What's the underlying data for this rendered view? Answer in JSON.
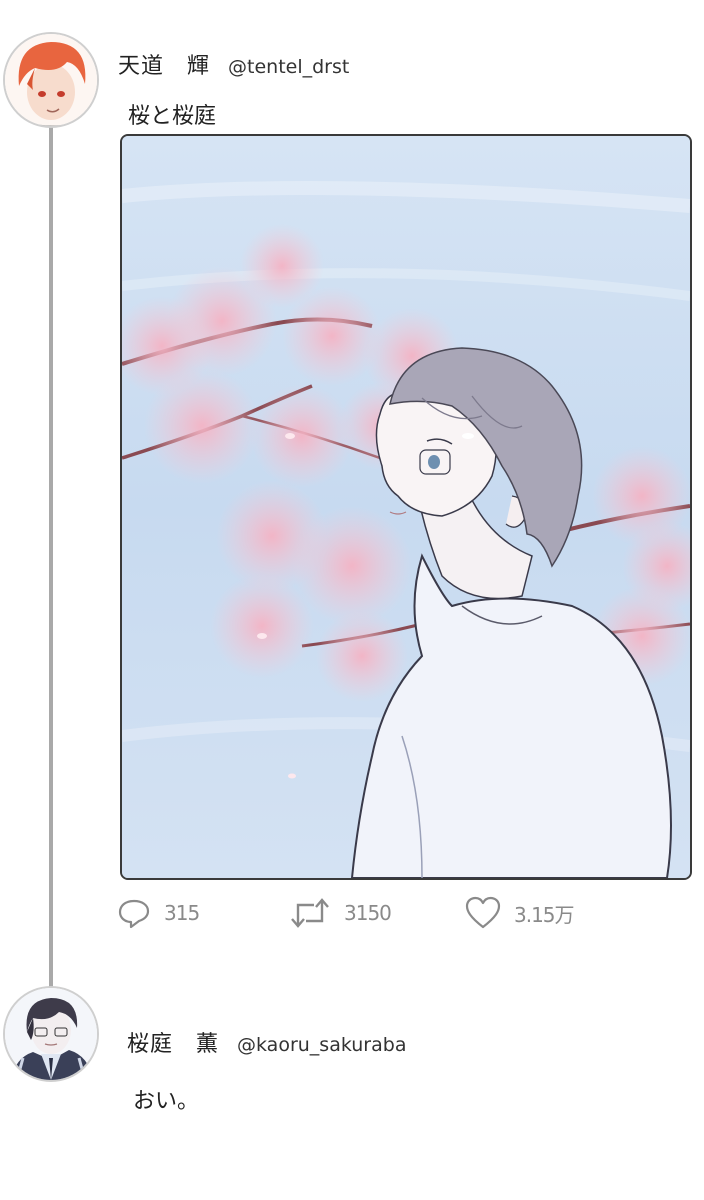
{
  "thread": [
    {
      "author": {
        "display_name": "天道　輝",
        "handle": "@tentel_drst"
      },
      "text": "桜と桜庭",
      "actions": {
        "reply_count": "315",
        "retweet_count": "3150",
        "like_count": "3.15万"
      }
    },
    {
      "author": {
        "display_name": "桜庭　薫",
        "handle": "@kaoru_sakuraba"
      },
      "text": "おい。"
    }
  ],
  "icons": [
    "reply-icon",
    "retweet-icon",
    "like-icon"
  ],
  "colors": {
    "thread_line": "#a9a9a9",
    "action_gray": "#8a8a8a",
    "sky": "#c9dcf0",
    "blossom": "#f2b9c8"
  }
}
